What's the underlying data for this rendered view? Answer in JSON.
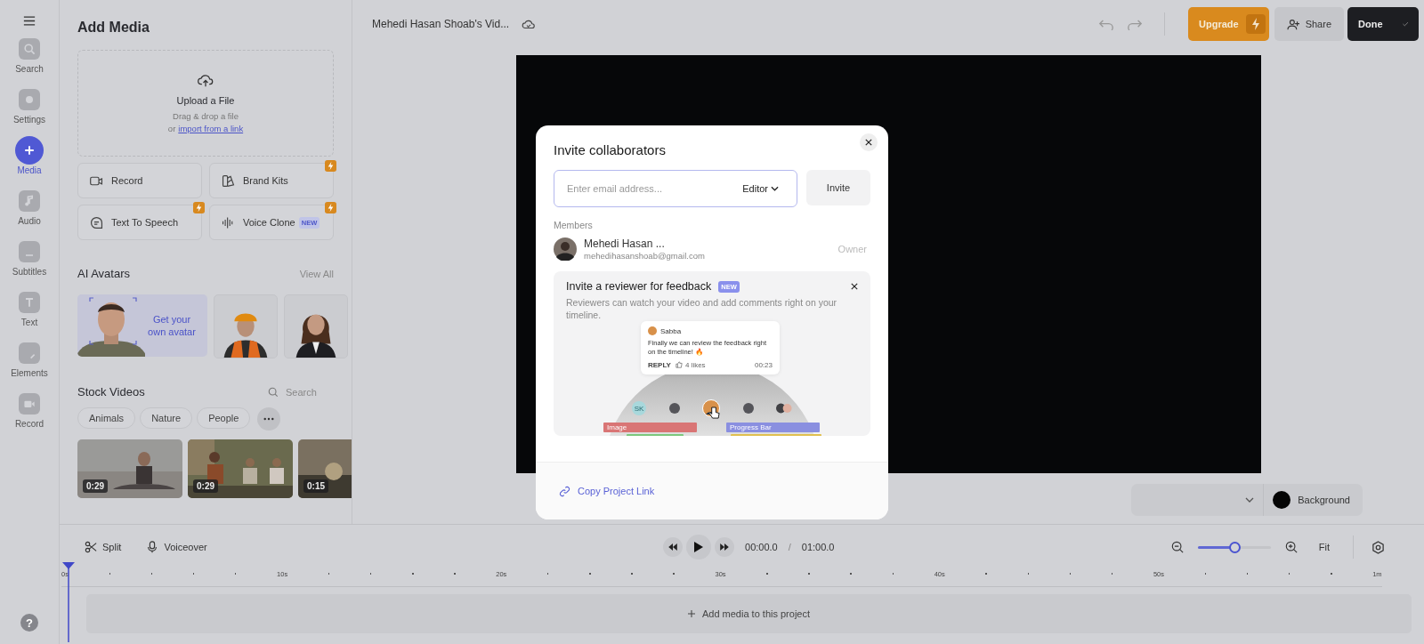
{
  "rail": {
    "items": [
      {
        "label": "Search",
        "selected": false
      },
      {
        "label": "Settings",
        "selected": false
      },
      {
        "label": "Media",
        "selected": true
      },
      {
        "label": "Audio",
        "selected": false
      },
      {
        "label": "Subtitles",
        "selected": false
      },
      {
        "label": "Text",
        "selected": false
      },
      {
        "label": "Elements",
        "selected": false
      },
      {
        "label": "Record",
        "selected": false
      }
    ],
    "help": "?"
  },
  "panel": {
    "title": "Add Media",
    "upload": {
      "title": "Upload a File",
      "hint": "Drag & drop a file",
      "or": "or",
      "link": "import from a link"
    },
    "tools": [
      {
        "label": "Record",
        "premium": false
      },
      {
        "label": "Brand Kits",
        "premium": true
      },
      {
        "label": "Text To Speech",
        "premium": true
      },
      {
        "label": "Voice Clone",
        "premium": true,
        "badge": "NEW"
      }
    ],
    "avatars": {
      "title": "AI Avatars",
      "view_all": "View All",
      "promo": "Get your own avatar"
    },
    "stock": {
      "title": "Stock Videos",
      "search_placeholder": "Search",
      "chips": [
        "Animals",
        "Nature",
        "People"
      ],
      "videos": [
        {
          "duration": "0:29"
        },
        {
          "duration": "0:29"
        },
        {
          "duration": "0:15"
        }
      ]
    }
  },
  "topbar": {
    "title": "Mehedi Hasan Shoab's Vid...",
    "upgrade": "Upgrade",
    "share": "Share",
    "done": "Done"
  },
  "canvas": {
    "background": "Background"
  },
  "timeline": {
    "tools": [
      "Split",
      "Voiceover"
    ],
    "current": "00:00.0",
    "separator": "/",
    "total": "01:00.0",
    "zoom": {
      "level": 0.5
    },
    "fit": "Fit",
    "ruler": [
      "0s",
      "10s",
      "20s",
      "30s",
      "40s",
      "50s",
      "1m"
    ],
    "add_media": "Add media to this project"
  },
  "modal": {
    "title": "Invite collaborators",
    "email_placeholder": "Enter email address...",
    "role": "Editor",
    "invite": "Invite",
    "members_label": "Members",
    "members": [
      {
        "name": "Mehedi Hasan ...",
        "email": "mehedihasanshoab@gmail.com",
        "role": "Owner"
      }
    ],
    "reviewer": {
      "title": "Invite a reviewer for feedback",
      "badge": "NEW",
      "text": "Reviewers can watch your video and add comments right on your timeline.",
      "comment": {
        "author": "Sabba",
        "text": "Finally we can review the feedback right on the timeline! 🔥",
        "reply": "REPLY",
        "likes": "4 likes",
        "time": "00:23"
      },
      "initials": "SK",
      "tracks": [
        "Image",
        "Progress Bar"
      ]
    },
    "copy_link": "Copy Project Link"
  }
}
